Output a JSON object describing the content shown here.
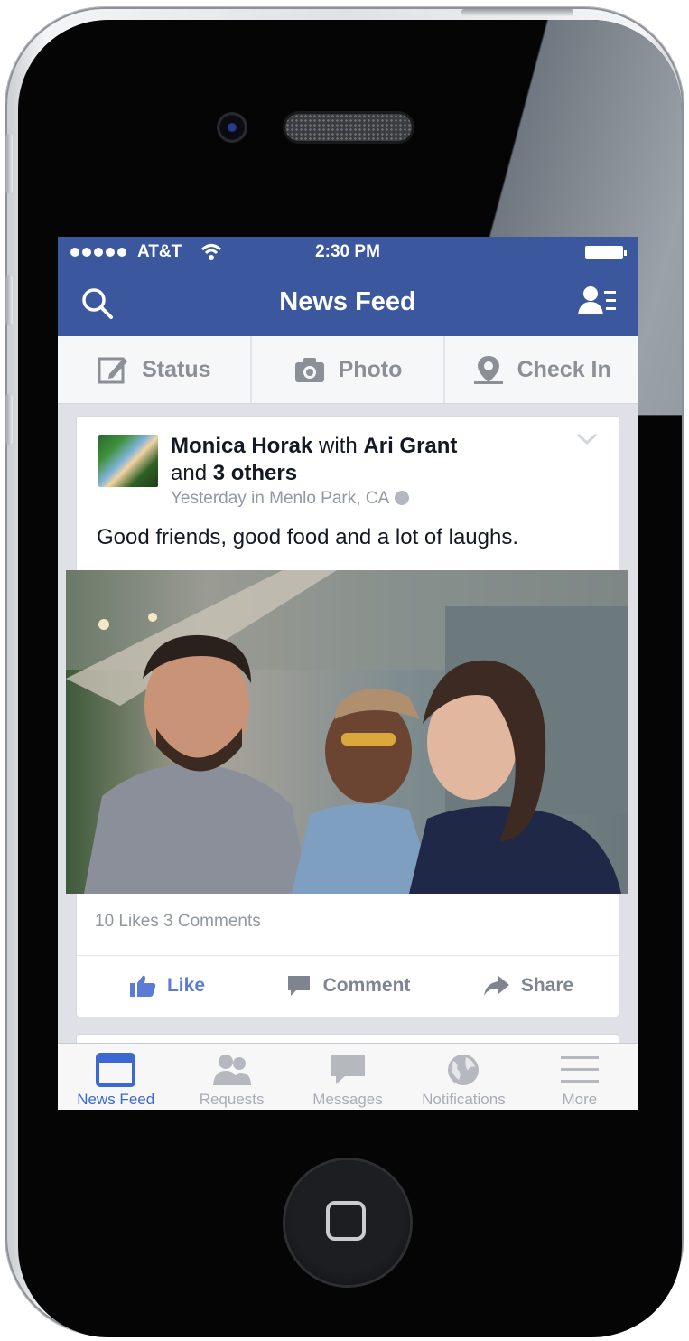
{
  "status_bar": {
    "carrier": "AT&T",
    "time": "2:30 PM"
  },
  "nav": {
    "title": "News Feed"
  },
  "composer": {
    "items": [
      {
        "label": "Status"
      },
      {
        "label": "Photo"
      },
      {
        "label": "Check In"
      }
    ]
  },
  "post": {
    "author": "Monica Horak",
    "connector": "with",
    "tagged_name": "Ari Grant",
    "and_text": "and",
    "others_text": "3 others",
    "meta": "Yesterday in Menlo Park, CA",
    "text": "Good friends, good food and a lot of laughs.",
    "stats": "10 Likes  3 Comments",
    "actions": {
      "like": "Like",
      "comment": "Comment",
      "share": "Share"
    }
  },
  "tabs": [
    {
      "label": "News Feed",
      "icon": "news-feed-icon"
    },
    {
      "label": "Requests",
      "icon": "requests-icon"
    },
    {
      "label": "Messages",
      "icon": "messages-icon"
    },
    {
      "label": "Notifications",
      "icon": "notifications-icon"
    },
    {
      "label": "More",
      "icon": "more-icon"
    }
  ],
  "colors": {
    "brand": "#3b579d",
    "active_tab": "#3b69d1",
    "link": "#5b7bd5"
  }
}
